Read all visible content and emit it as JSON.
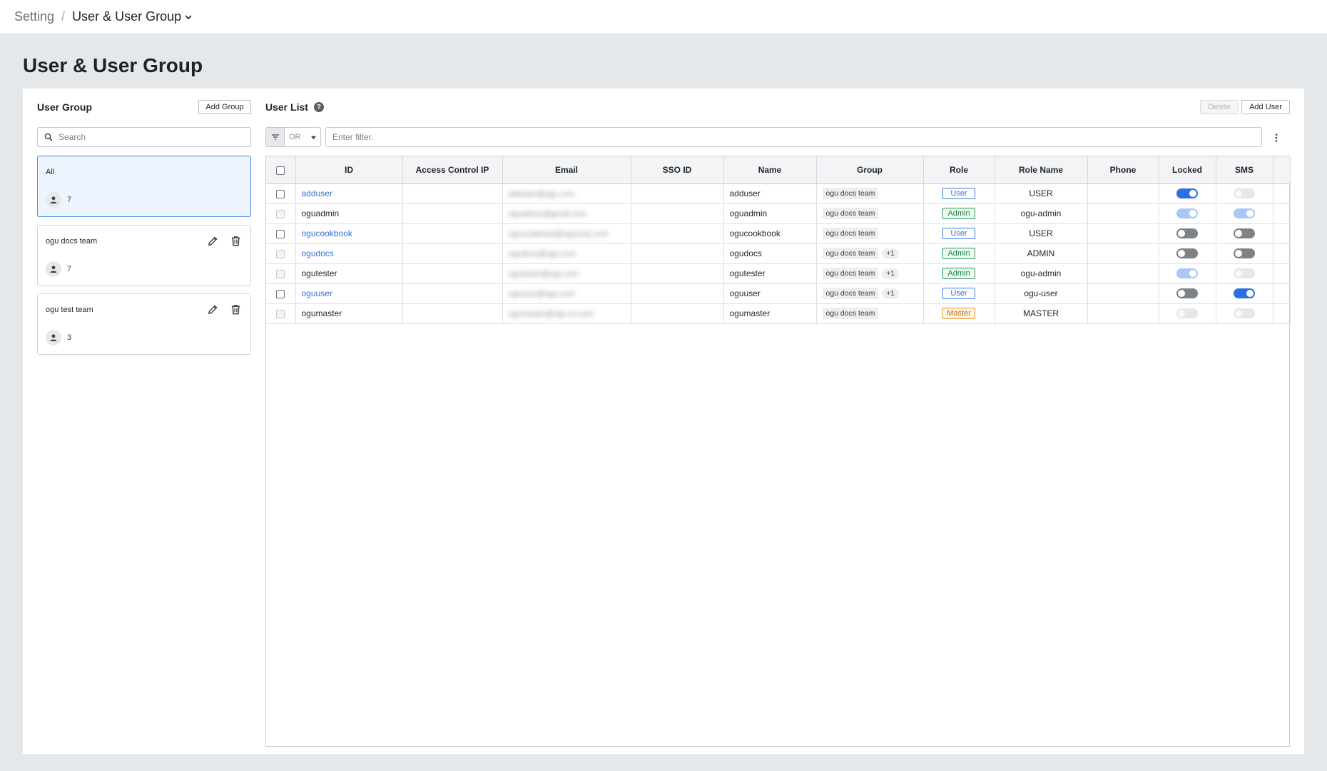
{
  "breadcrumb": {
    "root": "Setting",
    "separator": "/",
    "current": "User & User Group"
  },
  "page_title": "User & User Group",
  "user_group_panel": {
    "title": "User Group",
    "add_button": "Add Group",
    "search_placeholder": "Search",
    "groups": [
      {
        "name": "All",
        "count": "7",
        "selected": true,
        "editable": false
      },
      {
        "name": "ogu docs team",
        "count": "7",
        "selected": false,
        "editable": true
      },
      {
        "name": "ogu test team",
        "count": "3",
        "selected": false,
        "editable": true
      }
    ]
  },
  "user_list_panel": {
    "title": "User List",
    "help_icon": "?",
    "delete_button": "Delete",
    "add_button": "Add User",
    "filter_operator": "OR",
    "filter_placeholder": "Enter filter.",
    "columns": [
      "ID",
      "Access Control IP",
      "Email",
      "SSO ID",
      "Name",
      "Group",
      "Role",
      "Role Name",
      "Phone",
      "Locked",
      "SMS"
    ],
    "rows": [
      {
        "id": "adduser",
        "id_link": true,
        "checkbox_disabled": false,
        "access_ip": "",
        "email": "adduser@ogu.com",
        "sso_id": "",
        "name": "adduser",
        "group": "ogu docs team",
        "group_extra": "",
        "role": "User",
        "role_name": "USER",
        "phone": "",
        "locked": "on",
        "sms": "off-disabled"
      },
      {
        "id": "oguadmin",
        "id_link": false,
        "checkbox_disabled": true,
        "access_ip": "",
        "email": "oguadmin@gmail.com",
        "sso_id": "",
        "name": "oguadmin",
        "group": "ogu docs team",
        "group_extra": "",
        "role": "Admin",
        "role_name": "ogu-admin",
        "phone": "",
        "locked": "on-disabled",
        "sms": "on-disabled"
      },
      {
        "id": "ogucookbook",
        "id_link": true,
        "checkbox_disabled": false,
        "access_ip": "",
        "email": "ogucookbook@ogucorp.com",
        "sso_id": "",
        "name": "ogucookbook",
        "group": "ogu docs team",
        "group_extra": "",
        "role": "User",
        "role_name": "USER",
        "phone": "",
        "locked": "off",
        "sms": "off"
      },
      {
        "id": "ogudocs",
        "id_link": true,
        "checkbox_disabled": true,
        "access_ip": "",
        "email": "ogudocs@ogu.com",
        "sso_id": "",
        "name": "ogudocs",
        "group": "ogu docs team",
        "group_extra": "+1",
        "role": "Admin",
        "role_name": "ADMIN",
        "phone": "",
        "locked": "off",
        "sms": "off"
      },
      {
        "id": "ogutester",
        "id_link": false,
        "checkbox_disabled": true,
        "access_ip": "",
        "email": "ogutester@ogu.com",
        "sso_id": "",
        "name": "ogutester",
        "group": "ogu docs team",
        "group_extra": "+1",
        "role": "Admin",
        "role_name": "ogu-admin",
        "phone": "",
        "locked": "on-disabled",
        "sms": "off-disabled"
      },
      {
        "id": "oguuser",
        "id_link": true,
        "checkbox_disabled": false,
        "access_ip": "",
        "email": "oguuser@ogu.com",
        "sso_id": "",
        "name": "oguuser",
        "group": "ogu docs team",
        "group_extra": "+1",
        "role": "User",
        "role_name": "ogu-user",
        "phone": "",
        "locked": "off",
        "sms": "on"
      },
      {
        "id": "ogumaster",
        "id_link": false,
        "checkbox_disabled": true,
        "access_ip": "",
        "email": "ogumaster@ogu.co.com",
        "sso_id": "",
        "name": "ogumaster",
        "group": "ogu docs team",
        "group_extra": "",
        "role": "Master",
        "role_name": "MASTER",
        "phone": "",
        "locked": "off-disabled",
        "sms": "off-disabled"
      }
    ]
  },
  "colors": {
    "accent": "#2d6fe0",
    "link": "#2f6fd6",
    "admin": "#17803f",
    "master": "#c26a05"
  }
}
